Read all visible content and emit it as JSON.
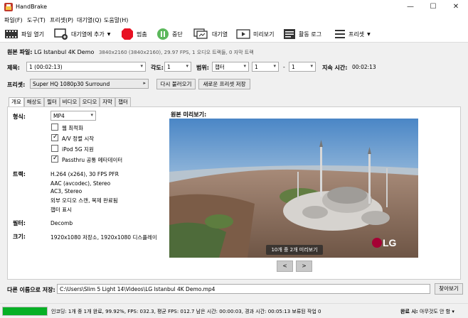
{
  "window": {
    "title": "HandBrake",
    "minimize_glyph": "—",
    "maximize_glyph": "☐",
    "close_glyph": "✕"
  },
  "menu": [
    {
      "label": "파일(F)"
    },
    {
      "label": "도구(T)"
    },
    {
      "label": "프리셋(P)"
    },
    {
      "label": "대기열(Q)"
    },
    {
      "label": "도움말(H)"
    }
  ],
  "toolbar": {
    "open_source": "파일 열기",
    "add_to_queue": "대기열에 추가",
    "add_dropdown_glyph": "▼",
    "stop": "멈춤",
    "pause": "중단",
    "queue": "대기열",
    "preview": "미리보기",
    "activity_log": "활동 로그",
    "presets": "프리셋",
    "presets_dropdown_glyph": "▼"
  },
  "source": {
    "label": "원본 파일:",
    "name": "LG Istanbul 4K Demo",
    "meta": "3840x2160 (3840x2160), 29.97 FPS, 1 오디오 트랙들, 0 자막 트랙"
  },
  "title_row": {
    "title_label": "제목:",
    "title_value": "1 (00:02:13)",
    "angle_label": "각도:",
    "angle_value": "1",
    "range_label": "범위:",
    "range_value": "챕터",
    "range_start": "1",
    "range_sep": "-",
    "range_end": "1",
    "duration_label": "지속 시간:",
    "duration_value": "00:02:13"
  },
  "preset_row": {
    "label": "프리셋:",
    "value": "Super HQ 1080p30 Surround",
    "reload_button": "다시 불러오기",
    "save_new_button": "새로운 프리셋 저장"
  },
  "tabs": [
    {
      "label": "개요"
    },
    {
      "label": "해상도"
    },
    {
      "label": "필터"
    },
    {
      "label": "비디오"
    },
    {
      "label": "오디오"
    },
    {
      "label": "자막"
    },
    {
      "label": "챕터"
    }
  ],
  "summary": {
    "format_label": "형식:",
    "format_value": "MP4",
    "web_optimized": "웹 최적화",
    "align_av": "A/V 정렬 시작",
    "ipod_support": "iPod 5G 지원",
    "passthru_metadata": "Passthru 공통 메타데이터",
    "checks": {
      "web_optimized": false,
      "align_av": true,
      "ipod_support": false,
      "passthru_metadata": true
    },
    "tracks_label": "트랙:",
    "tracks": [
      "H.264 (x264), 30 FPS PFR",
      "AAC (avcodec), Stereo",
      "AC3, Stereo",
      "외부 오디오 스캔, 복제 완료됨",
      "챕터 표시"
    ],
    "filters_label": "필터:",
    "filters_value": "Decomb",
    "size_label": "크기:",
    "size_value": "1920x1080 저장소, 1920x1080 디스플레이"
  },
  "preview": {
    "heading": "원본 미리보기:",
    "counter": "10개 중 2개 미리보기",
    "prev_glyph": "<",
    "next_glyph": ">",
    "watermark": "LG"
  },
  "save": {
    "label": "다른 이름으로 저장:",
    "path": "C:\\Users\\Slim 5 Light 14\\Videos\\LG Istanbul 4K Demo.mp4",
    "browse_button": "찾아보기"
  },
  "status": {
    "progress_percent": 99.92,
    "text": "인코딩: 1개 중 1개 완료, 99.92%, FPS: 032.3, 평균 FPS: 012.7 남은 시간: 00:00:03, 경과 시간: 00:05:13    보류된 작업 0",
    "done_label": "완료 시:",
    "done_value": "아무것도 안 함 ▾"
  },
  "colors": {
    "stop_red": "#e81123",
    "pause_green": "#5cb85c",
    "progress_green": "#06b025"
  }
}
